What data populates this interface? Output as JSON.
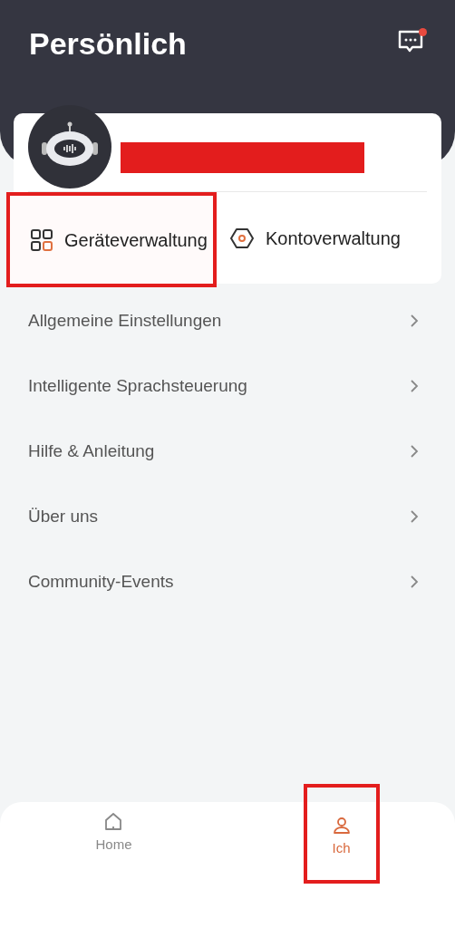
{
  "header": {
    "title": "Persönlich",
    "has_notification": true
  },
  "profile": {
    "name_redacted": true
  },
  "quick_actions": [
    {
      "kind": "devices",
      "label": "Geräteverwaltung",
      "highlighted": true
    },
    {
      "kind": "account",
      "label": "Kontoverwaltung",
      "highlighted": false
    }
  ],
  "menu": [
    {
      "label": "Allgemeine Einstellungen"
    },
    {
      "label": "Intelligente Sprachsteuerung"
    },
    {
      "label": "Hilfe & Anleitung"
    },
    {
      "label": "Über uns"
    },
    {
      "label": "Community-Events"
    }
  ],
  "bottom_nav": [
    {
      "kind": "home",
      "label": "Home",
      "selected": false,
      "highlighted": false
    },
    {
      "kind": "me",
      "label": "Ich",
      "selected": true,
      "highlighted": true
    }
  ]
}
